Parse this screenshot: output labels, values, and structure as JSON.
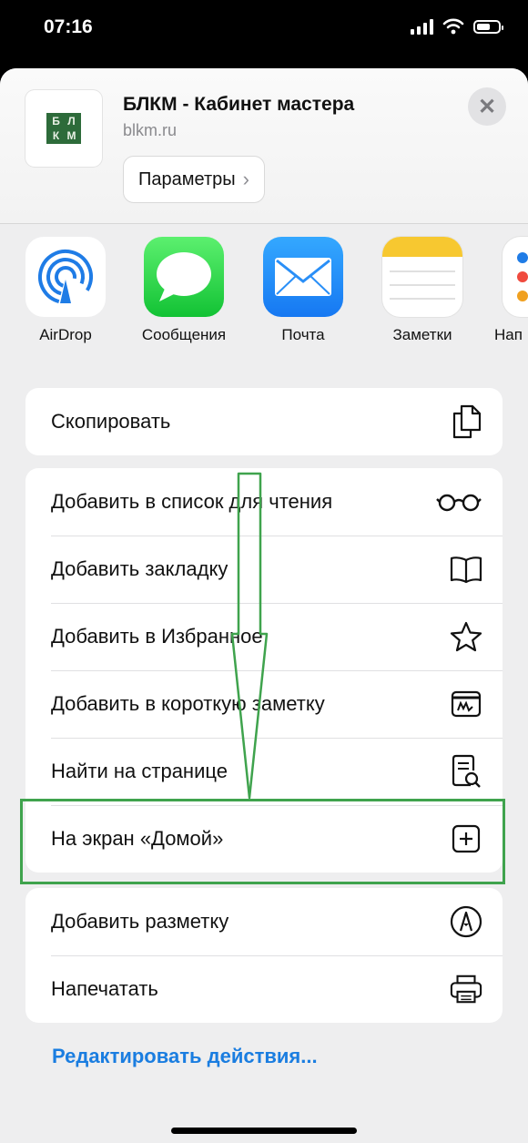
{
  "status_bar": {
    "time": "07:16"
  },
  "header": {
    "logo_letters": [
      "Б",
      "Л",
      "К",
      "М"
    ],
    "title": "БЛКМ - Кабинет мастера",
    "url": "blkm.ru",
    "params_label": "Параметры",
    "close_label": "✕"
  },
  "apps": [
    {
      "label": "AirDrop",
      "icon": "airdrop-icon"
    },
    {
      "label": "Сообщения",
      "icon": "messages-icon"
    },
    {
      "label": "Почта",
      "icon": "mail-icon"
    },
    {
      "label": "Заметки",
      "icon": "notes-icon"
    },
    {
      "label": "Нап",
      "icon": "reminders-icon"
    }
  ],
  "actions": {
    "copy": "Скопировать",
    "reading_list": "Добавить в список для чтения",
    "bookmark": "Добавить закладку",
    "favorites": "Добавить в Избранное",
    "quick_note": "Добавить в короткую заметку",
    "find": "Найти на странице",
    "home_screen": "На экран «Домой»",
    "markup": "Добавить разметку",
    "print": "Напечатать"
  },
  "edit_actions": "Редактировать действия...",
  "colors": {
    "accent": "#1a7de0",
    "annotation": "#3fa34d"
  }
}
